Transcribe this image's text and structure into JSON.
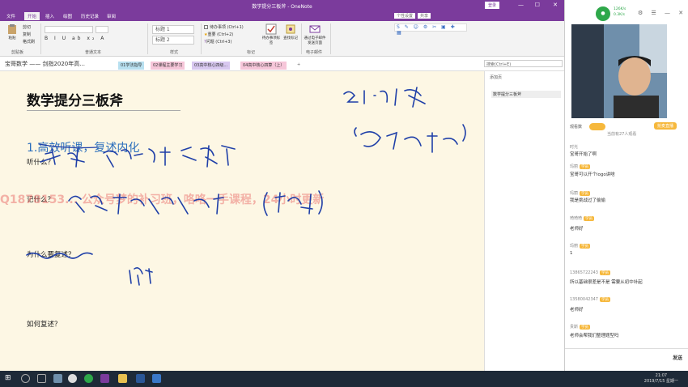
{
  "window": {
    "title": "数学提分三板斧 - OneNote",
    "signin_label": "登录",
    "min": "—",
    "max": "☐",
    "close": "✕"
  },
  "ribbon_tabs": [
    "文件",
    "开始",
    "插入",
    "绘图",
    "历史记录",
    "审阅"
  ],
  "ribbon_right": {
    "personal": "个性设置",
    "share": "共享"
  },
  "ribbon": {
    "paste_label": "粘贴",
    "clipboard_group": "剪贴板",
    "cut": "剪切",
    "copy": "复制",
    "format_painter": "格式刷",
    "basic_text_group": "普通文本",
    "styles": [
      "标题 1",
      "标题 2"
    ],
    "styles_group": "样式",
    "tags": [
      {
        "label": "待办事项 (Ctrl+1)"
      },
      {
        "label": "重要 (Ctrl+2)"
      },
      {
        "label": "问题 (Ctrl+3)"
      }
    ],
    "tags_group": "标记",
    "todo_tag": "待办事项标签",
    "find_tags": "查找标记",
    "email_page": "通过电子邮件发送页面",
    "email_group": "电子邮件"
  },
  "notebook": {
    "name": "宝哥数学 —— 剑指2020年高...",
    "section_tabs": [
      {
        "label": "01学法指导",
        "color": "#b8e0f0"
      },
      {
        "label": "02课程主要学习",
        "color": "#f6c6d9"
      },
      {
        "label": "03高中核心四级...",
        "color": "#d8c8f0"
      },
      {
        "label": "04高中核心四算（上）",
        "color": "#f6c6d9"
      }
    ],
    "search_placeholder": "搜索(Ctrl+E)"
  },
  "page": {
    "title": "数学提分三板斧",
    "heading1": "1.高效听课，复述内化",
    "q1": "听什么？",
    "q2": "记什么？",
    "q3": "为什么要复述？",
    "q4": "如何复述？",
    "watermark": "Q1878153... 公众号梦的补习班，咯咯一手课程，24小时更新"
  },
  "pagelist": {
    "add_page": "添加页",
    "items": [
      "数学提分三板斧"
    ]
  },
  "side": {
    "stats1": "126K/s",
    "stats2": "0.3K/s",
    "follow_label": "观看数",
    "record_label": "当前有27人观看",
    "followers_btn": "抢麦直播",
    "chat": [
      {
        "name": "时光",
        "badge": "",
        "msg": "宝哥开始了啊"
      },
      {
        "name": "玛丽",
        "badge": "学员",
        "msg": "宝哥可以开个logo讲啥"
      },
      {
        "name": "玛丽",
        "badge": "学员",
        "msg": "我是挑战过了偷偷"
      },
      {
        "name": "琦琦琦",
        "badge": "学员",
        "msg": "老师好"
      },
      {
        "name": "玛丽",
        "badge": "学员",
        "msg": "1"
      },
      {
        "name": "13865722243",
        "badge": "学员",
        "msg": "所以基础很差是不是 需要从初中补起"
      },
      {
        "name": "13580042347",
        "badge": "学员",
        "msg": "老师好"
      },
      {
        "name": "贵斯",
        "badge": "学员",
        "msg": "老师会帮我们整理题型吗"
      }
    ],
    "send_label": "发送"
  },
  "taskbar": {
    "time": "21:07",
    "date": "2019/7/15 星期一"
  },
  "colors": {
    "purple": "#7b3b9c",
    "ink": "#1f3fa8",
    "canvas": "#fdf7e4"
  }
}
